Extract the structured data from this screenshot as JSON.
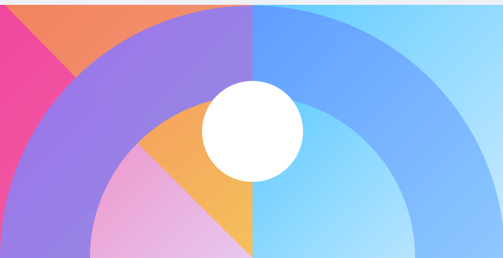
{
  "artwork": {
    "name": "abstract-gradient-rainbow-graphic",
    "colors": {
      "background_strip": "#eef0f6",
      "magenta": "#f0469f",
      "orange": "#f3825f",
      "amber": "#f5b65d",
      "violet": "#9a6ff2",
      "blue": "#5e9bff",
      "sky": "#5ccbff",
      "pale_sky": "#b6e4ff",
      "pink": "#ee93c8",
      "lavender": "#e7c8ee",
      "white": "#ffffff"
    },
    "shapes": [
      "top-strip",
      "left-magenta-triangle",
      "orange-wedge",
      "right-sky-panel",
      "outer-arch-left-violet",
      "outer-arch-right-blue",
      "inner-arch-left-pink-amber",
      "inner-arch-right-sky",
      "center-white-circle"
    ]
  }
}
